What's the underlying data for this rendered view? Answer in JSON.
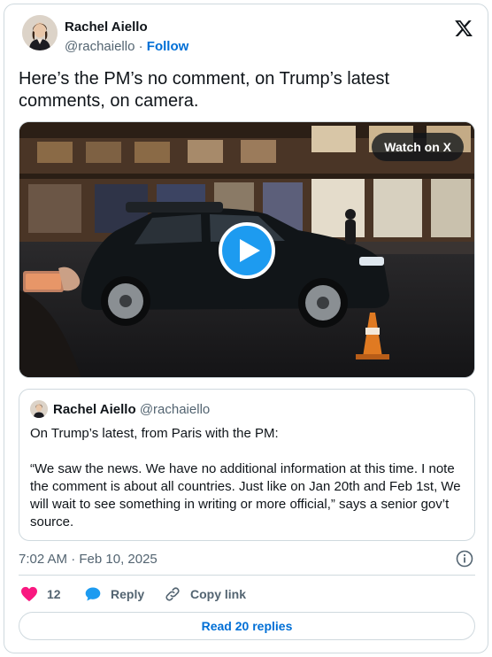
{
  "author": {
    "name": "Rachel Aiello",
    "handle": "@rachaiello",
    "separator": "·",
    "follow_label": "Follow"
  },
  "tweet": {
    "text": "Here’s the PM’s no comment, on Trump’s latest comments, on camera."
  },
  "media": {
    "watch_label": "Watch on X",
    "play_icon": "play-icon"
  },
  "quote": {
    "name": "Rachel Aiello",
    "handle": "@rachaiello",
    "text": "On Trump’s latest, from Paris with the PM:\n\n“We saw the news.  We have no additional information at this time. I note the comment is about all countries. Just like on Jan 20th and Feb 1st, We will wait to see something in writing or more official,” says a senior gov’t source."
  },
  "meta": {
    "timestamp": "7:02 AM · Feb 10, 2025"
  },
  "actions": {
    "like_count": "12",
    "reply_label": "Reply",
    "copy_label": "Copy link"
  },
  "footer": {
    "read_replies_label": "Read 20 replies"
  },
  "colors": {
    "accent": "#1d9bf0",
    "link": "#006fd6",
    "heart": "#f91880",
    "muted": "#536471",
    "border": "#cfd9de"
  }
}
